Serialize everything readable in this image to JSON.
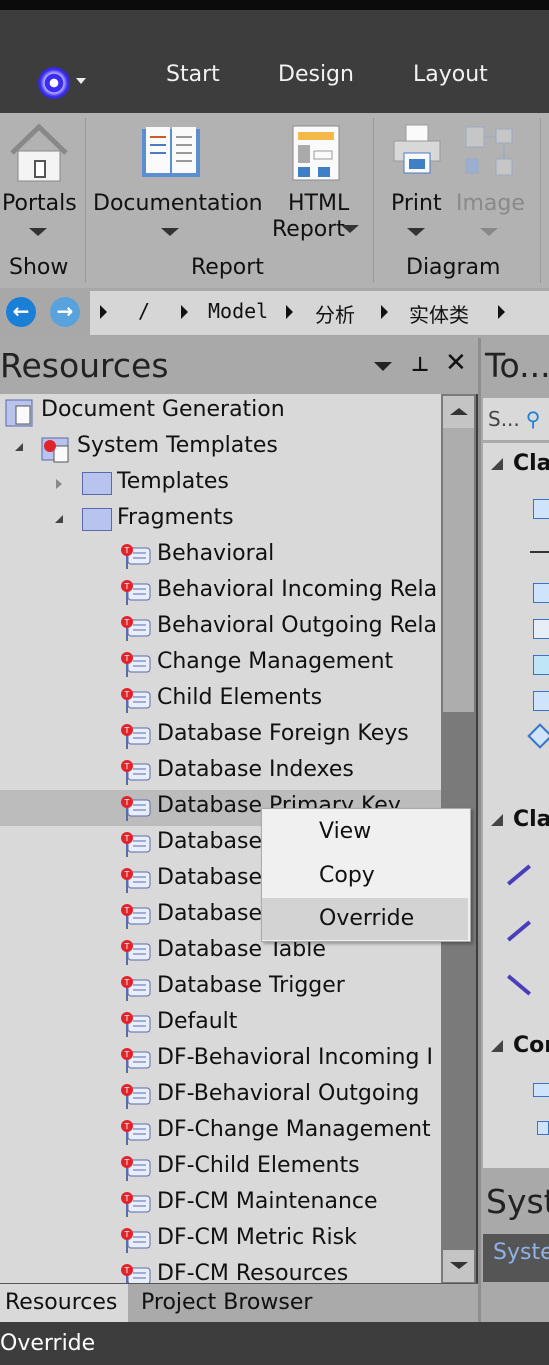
{
  "menubar": {
    "tabs": [
      "Start",
      "Design",
      "Layout"
    ],
    "logo_icon": "app-logo-icon"
  },
  "ribbon": {
    "groups": [
      {
        "label": "Show",
        "buttons": [
          {
            "label": "Portals",
            "icon": "home-icon"
          }
        ]
      },
      {
        "label": "Report",
        "buttons": [
          {
            "label": "Documentation",
            "icon": "book-icon"
          },
          {
            "label": "HTML",
            "label2": "Report",
            "icon": "html-report-icon"
          }
        ]
      },
      {
        "label": "Diagram",
        "buttons": [
          {
            "label": "Print",
            "icon": "printer-icon"
          },
          {
            "label": "Image",
            "icon": "image-icon",
            "disabled": true
          }
        ]
      }
    ]
  },
  "breadcrumb": {
    "items": [
      "/",
      "Model",
      "分析",
      "实体类"
    ]
  },
  "resources": {
    "title": "Resources",
    "tree": [
      {
        "label": "Document Generation",
        "level": 0,
        "icon": "document-generation-icon"
      },
      {
        "label": "System Templates",
        "level": 1,
        "icon": "system-templates-icon",
        "expanded": true
      },
      {
        "label": "Templates",
        "level": 2,
        "icon": "folder-icon",
        "expanded": false
      },
      {
        "label": "Fragments",
        "level": 2,
        "icon": "folder-icon",
        "expanded": true
      },
      {
        "label": "Behavioral",
        "level": 3,
        "icon": "fragment-icon"
      },
      {
        "label": "Behavioral Incoming Rela",
        "level": 3,
        "icon": "fragment-icon"
      },
      {
        "label": "Behavioral Outgoing Rela",
        "level": 3,
        "icon": "fragment-icon"
      },
      {
        "label": "Change Management",
        "level": 3,
        "icon": "fragment-icon"
      },
      {
        "label": "Child Elements",
        "level": 3,
        "icon": "fragment-icon"
      },
      {
        "label": "Database Foreign Keys",
        "level": 3,
        "icon": "fragment-icon"
      },
      {
        "label": "Database Indexes",
        "level": 3,
        "icon": "fragment-icon"
      },
      {
        "label": "Database Primary Key",
        "level": 3,
        "icon": "fragment-icon",
        "selected": true
      },
      {
        "label": "Database",
        "level": 3,
        "icon": "fragment-icon"
      },
      {
        "label": "Database",
        "level": 3,
        "icon": "fragment-icon"
      },
      {
        "label": "Database",
        "level": 3,
        "icon": "fragment-icon"
      },
      {
        "label": "Database Table",
        "level": 3,
        "icon": "fragment-icon"
      },
      {
        "label": "Database Trigger",
        "level": 3,
        "icon": "fragment-icon"
      },
      {
        "label": "Default",
        "level": 3,
        "icon": "fragment-icon"
      },
      {
        "label": "DF-Behavioral Incoming I",
        "level": 3,
        "icon": "fragment-icon"
      },
      {
        "label": "DF-Behavioral Outgoing",
        "level": 3,
        "icon": "fragment-icon"
      },
      {
        "label": "DF-Change Management",
        "level": 3,
        "icon": "fragment-icon"
      },
      {
        "label": "DF-Child Elements",
        "level": 3,
        "icon": "fragment-icon"
      },
      {
        "label": "DF-CM Maintenance",
        "level": 3,
        "icon": "fragment-icon"
      },
      {
        "label": "DF-CM Metric Risk",
        "level": 3,
        "icon": "fragment-icon"
      },
      {
        "label": "DF-CM Resources",
        "level": 3,
        "icon": "fragment-icon"
      }
    ]
  },
  "context_menu": {
    "items": [
      {
        "label": "View"
      },
      {
        "label": "Copy"
      },
      {
        "label": "Override",
        "highlighted": true
      }
    ]
  },
  "bottom_tabs": [
    {
      "label": "Resources",
      "active": true
    },
    {
      "label": "Project Browser",
      "active": false
    }
  ],
  "toolbox": {
    "title": "To...",
    "search": "S...",
    "sections": [
      "Cla",
      "Cla",
      "Cor"
    ],
    "bottom_title": "Syst",
    "bottom_tab": "Syste"
  },
  "status": {
    "text": "Override"
  },
  "colors": {
    "menubar": "#3d3d3d",
    "ribbon": "#b2b2b2",
    "tree_bg": "#d9d9d9",
    "selection": "#bcbcbc",
    "accent_blue": "#1a7fd6"
  }
}
